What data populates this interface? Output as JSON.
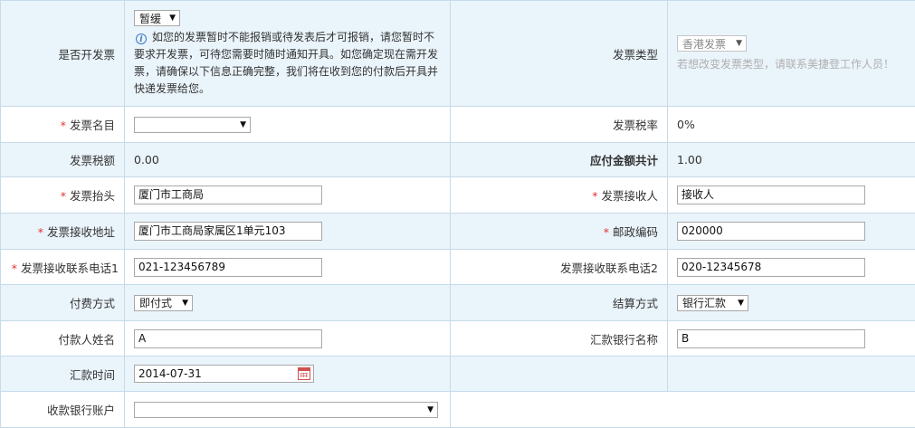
{
  "fields": {
    "invoice_open": {
      "label": "是否开发票",
      "select_value": "暂缓",
      "note": "如您的发票暂时不能报销或待发表后才可报销，请您暂时不要求开发票，可待您需要时随时通知开具。如您确定现在需开发票，请确保以下信息正确完整，我们将在收到您的付款后开具并快递发票给您。"
    },
    "invoice_type": {
      "label": "发票类型",
      "select_value": "香港发票",
      "hint": "若想改变发票类型，请联系美捷登工作人员！"
    },
    "invoice_item": {
      "required_mark": "*",
      "label": "发票名目",
      "select_value": ""
    },
    "invoice_tax_rate": {
      "label": "发票税率",
      "value": "0%"
    },
    "invoice_tax_amount": {
      "label": "发票税额",
      "value": "0.00"
    },
    "total_payable": {
      "label": "应付金额共计",
      "value": "1.00"
    },
    "invoice_title": {
      "required_mark": "*",
      "label": "发票抬头",
      "value": "厦门市工商局"
    },
    "invoice_receiver": {
      "required_mark": "*",
      "label": "发票接收人",
      "value": "接收人"
    },
    "invoice_address": {
      "required_mark": "*",
      "label": "发票接收地址",
      "value": "厦门市工商局家属区1单元103"
    },
    "postal_code": {
      "required_mark": "*",
      "label": "邮政编码",
      "value": "020000"
    },
    "phone1": {
      "required_mark": "*",
      "label": "发票接收联系电话1",
      "value": "021-123456789"
    },
    "phone2": {
      "label": "发票接收联系电话2",
      "value": "020-12345678"
    },
    "payment_method": {
      "label": "付费方式",
      "select_value": "即付式"
    },
    "settlement_method": {
      "label": "结算方式",
      "select_value": "银行汇款"
    },
    "payer_name": {
      "label": "付款人姓名",
      "value": "A"
    },
    "remit_bank": {
      "label": "汇款银行名称",
      "value": "B"
    },
    "remit_time": {
      "label": "汇款时间",
      "value": "2014-07-31"
    },
    "receive_bank_account": {
      "label": "收款银行账户",
      "select_value": ""
    }
  },
  "icons": {
    "info": "info-icon",
    "calendar": "calendar-icon",
    "dropdown": "chevron-down-icon"
  },
  "colors": {
    "required": "#e0332f",
    "row_alt_bg": "#eaf4fb",
    "border": "#c6dae8",
    "hint": "#b0b0b0"
  }
}
